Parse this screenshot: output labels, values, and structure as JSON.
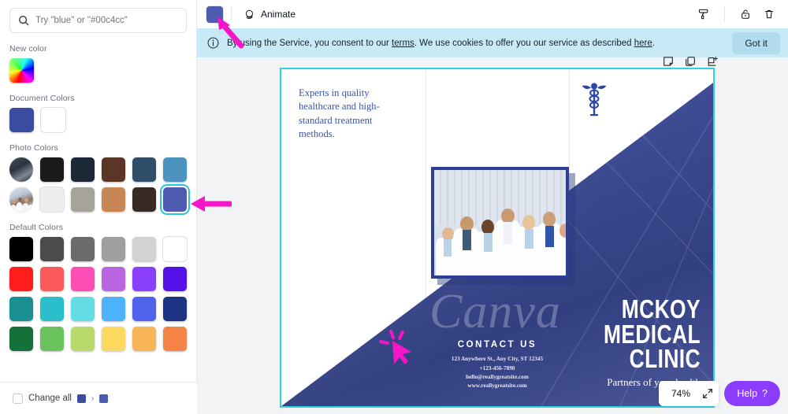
{
  "side": {
    "search": {
      "placeholder": "Try \"blue\" or \"#00c4cc\"",
      "value": "",
      "icon": "search-icon"
    },
    "sections": {
      "new_color": {
        "label": "New color"
      },
      "document_colors": {
        "label": "Document Colors",
        "swatches": [
          "#3a4ba0",
          "#ffffff"
        ]
      },
      "photo_colors": {
        "label": "Photo Colors",
        "row1": [
          "avatar-1",
          "#1b1b1d",
          "#1d2936",
          "#5b3526",
          "#2f4f68",
          "#4d93bf"
        ],
        "row2": [
          "avatar-2",
          "#eceef0",
          "#a6a49a",
          "#c98655",
          "#372b24",
          "#4e5bb0"
        ],
        "selected": "#4e5bb0"
      },
      "default_colors": {
        "label": "Default Colors",
        "rows": [
          [
            "#000000",
            "#4b4b4b",
            "#6b6b6b",
            "#9f9f9f",
            "#d2d2d2",
            "#ffffff"
          ],
          [
            "#ff1d1d",
            "#fc5a5a",
            "#fb4fb6",
            "#b964e0",
            "#8a3ffc",
            "#5411e8"
          ],
          [
            "#1a8f94",
            "#2bbecb",
            "#63dde3",
            "#4cb2fb",
            "#4f63ec",
            "#1d3383"
          ],
          [
            "#15713a",
            "#69c25b",
            "#b8d96b",
            "#fcd95e",
            "#f8b558",
            "#f58345"
          ]
        ]
      }
    },
    "change_all": {
      "label": "Change all",
      "checked": false,
      "from_color": "#3a4ba0",
      "to_color": "#4e5bb0",
      "separator": "›"
    }
  },
  "topbar": {
    "color_swatch": "#4e5bb0",
    "animate_label": "Animate",
    "animate_icon": "animate-icon",
    "tools": [
      {
        "name": "paint-roller-icon"
      },
      {
        "name": "lock-icon"
      },
      {
        "name": "trash-icon"
      }
    ]
  },
  "cookie_banner": {
    "icon": "info-icon",
    "text_before": "By using the Service, you consent to our ",
    "link1": "terms",
    "text_middle": ". We use cookies to offer you our service as described ",
    "link2": "here",
    "text_after": ".",
    "button": "Got it",
    "background": "#c8eaf7"
  },
  "canvas_tools": [
    {
      "name": "notes-icon"
    },
    {
      "name": "duplicate-page-icon"
    },
    {
      "name": "add-page-icon"
    }
  ],
  "document": {
    "blurb": "Experts in quality healthcare and high-standard treatment methods.",
    "watermark": "Canva",
    "contact": {
      "heading": "CONTACT US",
      "address": "123 Anywhere St., Any City, ST 12345",
      "phone": "+123-456-7890",
      "email": "hello@reallygreatsite.com",
      "website": "www.reallygreatsite.com"
    },
    "clinic_name": [
      "MCKOY",
      "MEDICAL",
      "CLINIC"
    ],
    "tagline": "Partners of your health",
    "accent_blue": "#3a4ba0",
    "selection_color": "#2fd0e0"
  },
  "footer": {
    "zoom_percent": "74%",
    "fullscreen_icon": "fullscreen-icon",
    "help_label": "Help",
    "help_mark": "?",
    "help_color": "#8b3dff"
  }
}
